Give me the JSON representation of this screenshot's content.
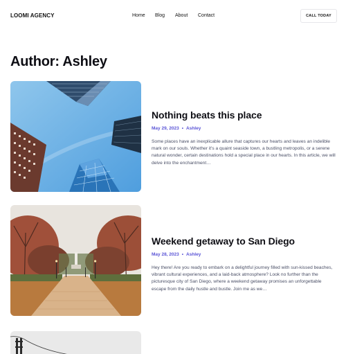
{
  "header": {
    "logo": "LOOMI AGENCY",
    "nav": [
      "Home",
      "Blog",
      "About",
      "Contact"
    ],
    "cta": "CALL TODAY"
  },
  "page": {
    "title": "Author: Ashley"
  },
  "posts": [
    {
      "title": "Nothing beats this place",
      "date": "May 29, 2023",
      "author": "Ashley",
      "excerpt": "Some places have an inexplicable allure that captures our hearts and leaves an indelible mark on our souls. Whether it's a quaint seaside town, a bustling metropolis, or a serene natural wonder, certain destinations hold a special place in our hearts. In this article, we will delve into the enchantment…"
    },
    {
      "title": "Weekend getaway to San Diego",
      "date": "May 28, 2023",
      "author": "Ashley",
      "excerpt": "Hey there! Are you ready to embark on a delightful journey filled with sun-kissed beaches, vibrant cultural experiences, and a laid-back atmosphere? Look no further than the picturesque city of San Diego, where a weekend getaway promises an unforgettable escape from the daily hustle and bustle. Join me as we…"
    }
  ],
  "colors": {
    "accent": "#5a54d6",
    "text": "#111118",
    "muted": "#4a4f66"
  }
}
